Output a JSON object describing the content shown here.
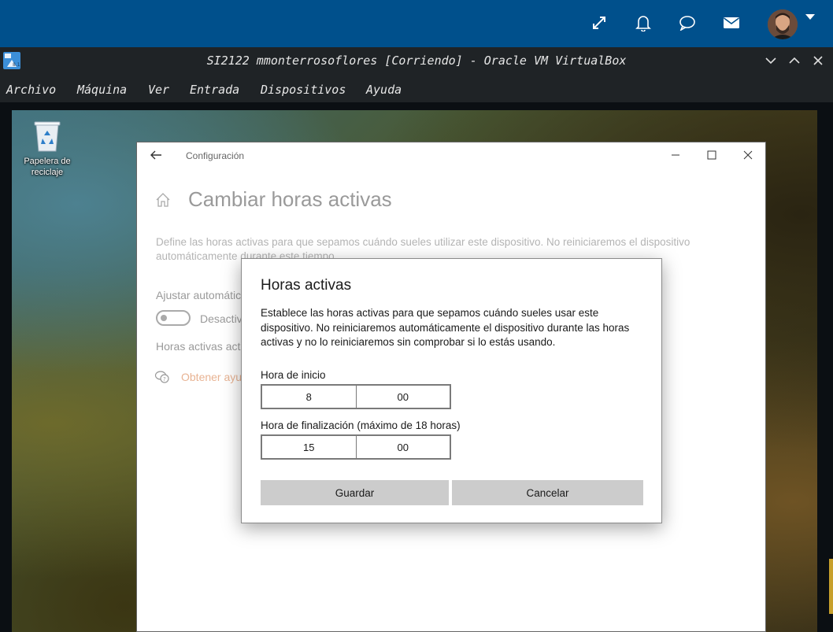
{
  "topbar": {
    "icons": [
      "fullscreen-icon",
      "bell-icon",
      "chat-icon",
      "mail-icon"
    ],
    "accent": "#00508c"
  },
  "vbox": {
    "title": "SI2122 mmonterrosoflores [Corriendo] - Oracle VM VirtualBox",
    "menu": [
      "Archivo",
      "Máquina",
      "Ver",
      "Entrada",
      "Dispositivos",
      "Ayuda"
    ]
  },
  "desktop": {
    "recycle_bin_label": "Papelera de reciclaje"
  },
  "settings": {
    "caption": "Configuración",
    "heading": "Cambiar horas activas",
    "description": "Define las horas activas para que sepamos cuándo sueles utilizar este dispositivo. No reiniciaremos el dispositivo automáticamente durante este tiempo.",
    "adjust_label": "Ajustar automátic",
    "toggle_state": "Desactiv",
    "current_hours_label": "Horas activas actu",
    "help_link": "Obtener ayu"
  },
  "dialog": {
    "title": "Horas activas",
    "body": "Establece las horas activas para que sepamos cuándo sueles usar este dispositivo. No reiniciaremos automáticamente el dispositivo durante las horas activas y no lo reiniciaremos sin comprobar si lo estás usando.",
    "start_label": "Hora de inicio",
    "start_hour": "8",
    "start_minute": "00",
    "end_label": "Hora de finalización (máximo de 18 horas)",
    "end_hour": "15",
    "end_minute": "00",
    "save_label": "Guardar",
    "cancel_label": "Cancelar"
  }
}
